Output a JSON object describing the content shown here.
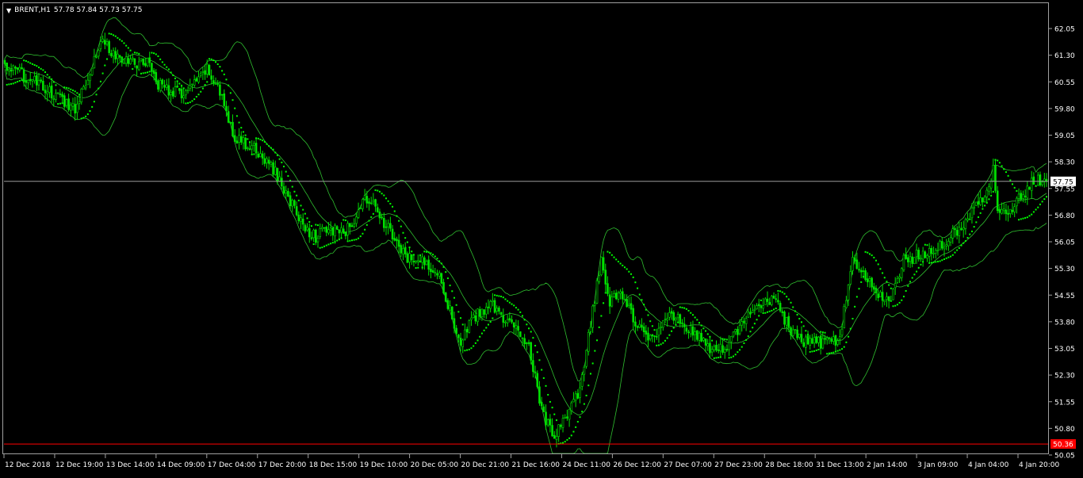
{
  "header": {
    "symbol_label": "BRENT,H1",
    "ohlc_text": "57.78 57.84 57.73 57.75"
  },
  "colors": {
    "background": "#000000",
    "candles": "#00e000",
    "bands": "#2fbf2f",
    "sar": "#00ff00",
    "bid_line": "#9a9a9a",
    "low_line": "#ff0000",
    "axis_text": "#ffffff"
  },
  "chart_data": {
    "type": "candlestick",
    "title": "BRENT,H1",
    "indicators": [
      "Bollinger Bands",
      "Parabolic SAR"
    ],
    "y_ticks": [
      62.05,
      61.3,
      60.55,
      59.8,
      59.05,
      58.3,
      57.55,
      56.8,
      56.05,
      55.3,
      54.55,
      53.8,
      53.05,
      52.3,
      51.55,
      50.8,
      50.05
    ],
    "ylim": [
      50.05,
      62.4
    ],
    "x_ticks": [
      "12 Dec 2018",
      "12 Dec 19:00",
      "13 Dec 14:00",
      "14 Dec 09:00",
      "17 Dec 04:00",
      "17 Dec 20:00",
      "18 Dec 15:00",
      "19 Dec 10:00",
      "20 Dec 05:00",
      "20 Dec 21:00",
      "21 Dec 16:00",
      "24 Dec 11:00",
      "26 Dec 12:00",
      "27 Dec 07:00",
      "27 Dec 23:00",
      "28 Dec 18:00",
      "31 Dec 13:00",
      "2 Jan 14:00",
      "3 Jan 09:00",
      "4 Jan 04:00",
      "4 Jan 20:00"
    ],
    "current_price": 57.75,
    "current_price_label": "57.75",
    "low_line": 50.36,
    "low_line_label": "50.36",
    "close_path": [
      [
        0,
        61.0
      ],
      [
        10,
        60.7
      ],
      [
        20,
        60.3
      ],
      [
        28,
        60.0
      ],
      [
        33,
        59.8
      ],
      [
        38,
        60.6
      ],
      [
        46,
        61.8
      ],
      [
        52,
        61.2
      ],
      [
        60,
        61.1
      ],
      [
        68,
        61.1
      ],
      [
        72,
        60.5
      ],
      [
        78,
        60.3
      ],
      [
        83,
        60.2
      ],
      [
        90,
        60.5
      ],
      [
        95,
        60.9
      ],
      [
        100,
        60.4
      ],
      [
        108,
        59.0
      ],
      [
        118,
        58.6
      ],
      [
        126,
        58.1
      ],
      [
        134,
        57.2
      ],
      [
        140,
        56.5
      ],
      [
        146,
        56.2
      ],
      [
        152,
        56.4
      ],
      [
        160,
        56.3
      ],
      [
        170,
        57.3
      ],
      [
        176,
        56.8
      ],
      [
        182,
        56.2
      ],
      [
        188,
        55.6
      ],
      [
        196,
        55.5
      ],
      [
        204,
        55.2
      ],
      [
        208,
        54.3
      ],
      [
        214,
        53.2
      ],
      [
        220,
        53.9
      ],
      [
        228,
        54.3
      ],
      [
        236,
        53.8
      ],
      [
        246,
        53.2
      ],
      [
        252,
        51.3
      ],
      [
        258,
        50.5
      ],
      [
        264,
        51.2
      ],
      [
        270,
        51.8
      ],
      [
        276,
        54.1
      ],
      [
        280,
        55.5
      ],
      [
        284,
        54.3
      ],
      [
        288,
        54.7
      ],
      [
        296,
        53.8
      ],
      [
        304,
        53.3
      ],
      [
        312,
        54.0
      ],
      [
        320,
        53.7
      ],
      [
        328,
        53.2
      ],
      [
        334,
        52.9
      ],
      [
        340,
        53.2
      ],
      [
        348,
        53.9
      ],
      [
        356,
        54.3
      ],
      [
        362,
        54.5
      ],
      [
        368,
        53.6
      ],
      [
        376,
        53.2
      ],
      [
        384,
        53.2
      ],
      [
        392,
        53.3
      ],
      [
        398,
        55.6
      ],
      [
        404,
        55.0
      ],
      [
        410,
        54.6
      ],
      [
        416,
        54.4
      ],
      [
        422,
        55.5
      ],
      [
        430,
        55.7
      ],
      [
        438,
        55.9
      ],
      [
        446,
        56.3
      ],
      [
        454,
        56.9
      ],
      [
        460,
        57.4
      ],
      [
        464,
        58.1
      ],
      [
        466,
        56.8
      ],
      [
        472,
        57.0
      ],
      [
        478,
        57.4
      ],
      [
        482,
        57.75
      ]
    ]
  }
}
